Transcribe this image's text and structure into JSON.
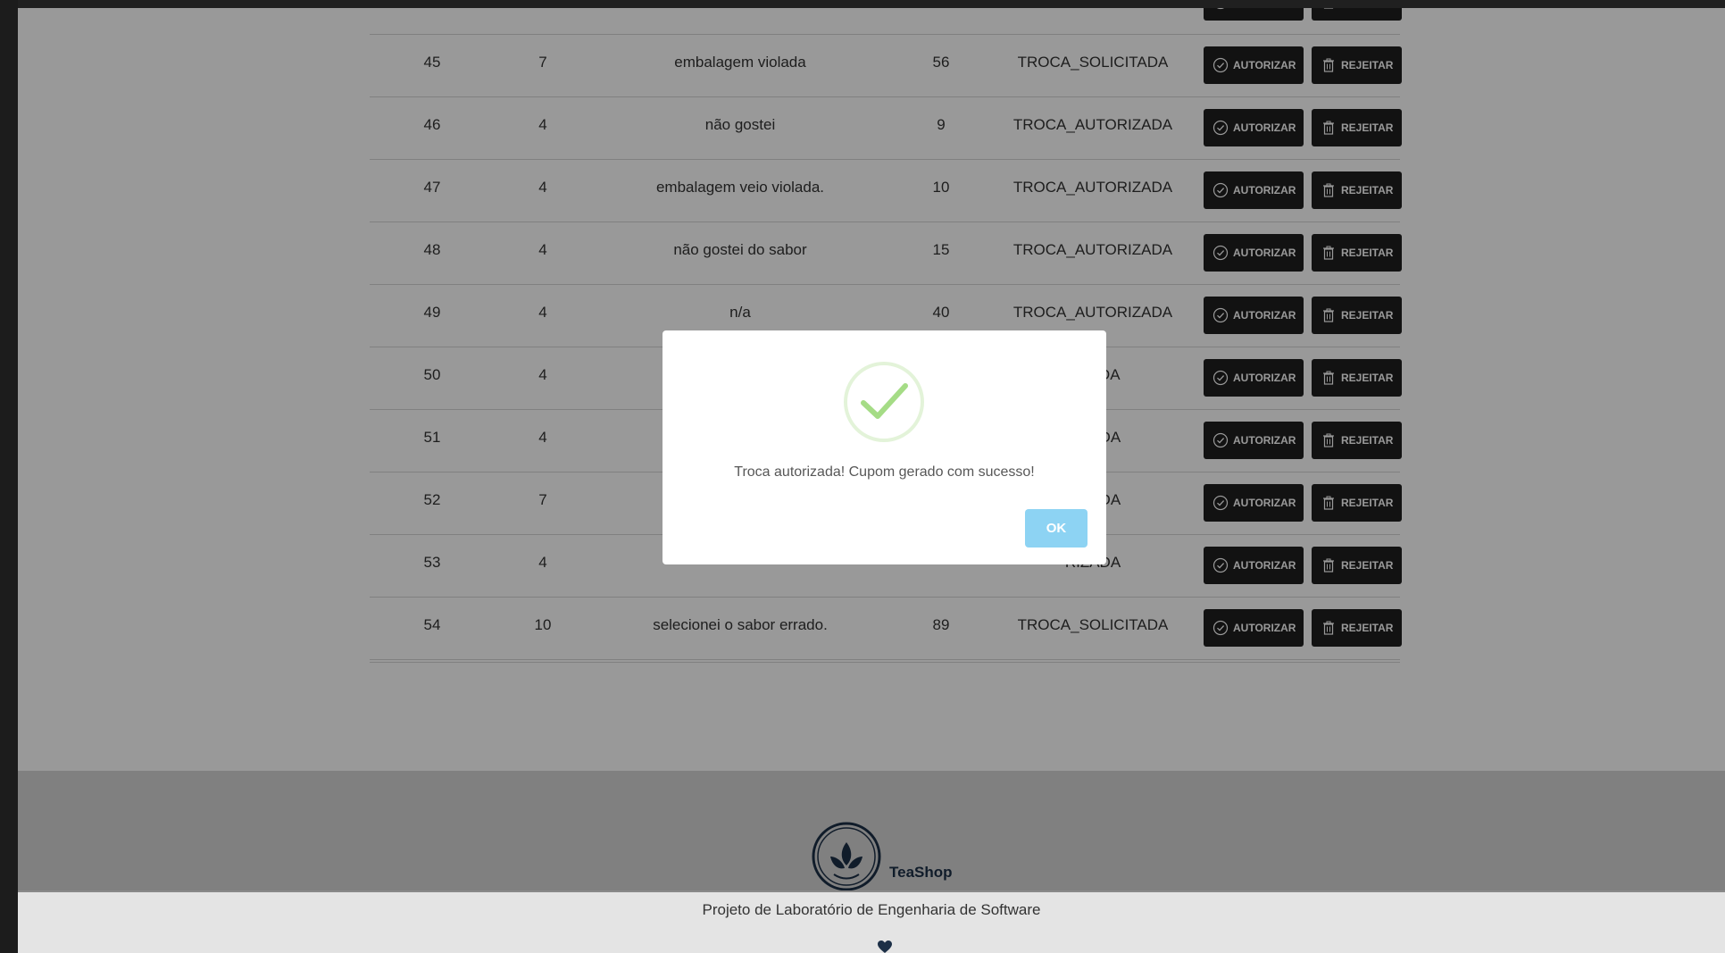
{
  "table": {
    "rows": [
      {
        "id": "45",
        "cliente": "7",
        "motivo": "embalagem violada",
        "pedido": "56",
        "status": "TROCA_SOLICITADA"
      },
      {
        "id": "46",
        "cliente": "4",
        "motivo": "não gostei",
        "pedido": "9",
        "status": "TROCA_AUTORIZADA"
      },
      {
        "id": "47",
        "cliente": "4",
        "motivo": "embalagem veio violada.",
        "pedido": "10",
        "status": "TROCA_AUTORIZADA"
      },
      {
        "id": "48",
        "cliente": "4",
        "motivo": "não gostei do sabor",
        "pedido": "15",
        "status": "TROCA_AUTORIZADA"
      },
      {
        "id": "49",
        "cliente": "4",
        "motivo": "n/a",
        "pedido": "40",
        "status": "TROCA_AUTORIZADA"
      },
      {
        "id": "50",
        "cliente": "4",
        "motivo": "",
        "pedido": "",
        "status": "CITADA"
      },
      {
        "id": "51",
        "cliente": "4",
        "motivo": "",
        "pedido": "",
        "status": "RIZADA"
      },
      {
        "id": "52",
        "cliente": "7",
        "motivo": "",
        "pedido": "",
        "status": "RIZADA"
      },
      {
        "id": "53",
        "cliente": "4",
        "motivo": "",
        "pedido": "",
        "status": "RIZADA"
      },
      {
        "id": "54",
        "cliente": "10",
        "motivo": "selecionei o sabor errado.",
        "pedido": "89",
        "status": "TROCA_SOLICITADA"
      }
    ],
    "authorize_label": "AUTORIZAR",
    "reject_label": "REJEITAR"
  },
  "dialog": {
    "message": "Troca autorizada! Cupom gerado com sucesso!",
    "ok_label": "OK",
    "icon": "success-check-icon",
    "icon_color": "#a5dc86"
  },
  "footer": {
    "brand": "TeaShop",
    "project_text": "Projeto de Laboratório de Engenharia de Software",
    "logo_icon": "teashop-leaf-logo",
    "heart_icon": "heart-icon"
  },
  "colors": {
    "action_button_bg": "#1f1f1f",
    "ok_button_bg": "#8dd3f3",
    "brand_color": "#1c2f47"
  }
}
